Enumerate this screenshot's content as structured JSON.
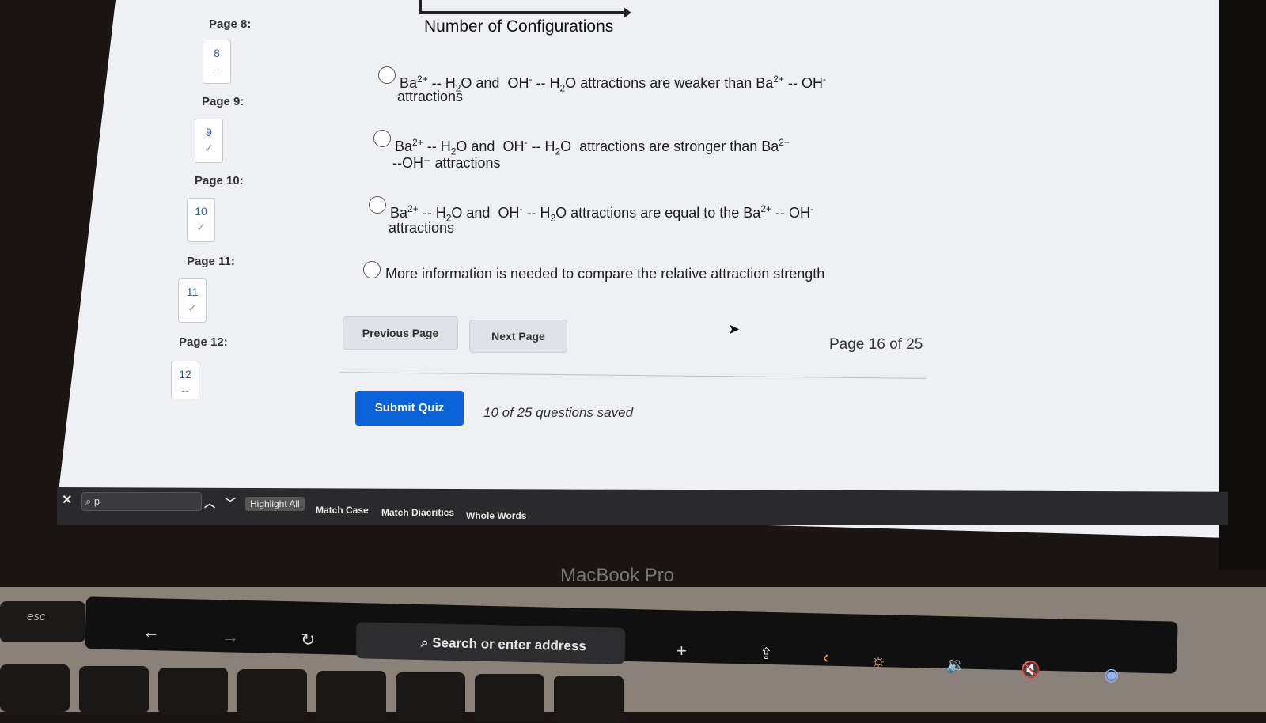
{
  "sidebar": {
    "pages": [
      {
        "label": "Page 8:",
        "number": "8",
        "status": "--"
      },
      {
        "label": "Page 9:",
        "number": "9",
        "status": "✓"
      },
      {
        "label": "Page 10:",
        "number": "10",
        "status": "✓"
      },
      {
        "label": "Page 11:",
        "number": "11",
        "status": "✓"
      },
      {
        "label": "Page 12:",
        "number": "12",
        "status": "--"
      }
    ]
  },
  "question": {
    "graph_label": "Number of Configurations",
    "options": [
      {
        "line1": "attractions are weaker than Ba",
        "line2": "attractions"
      },
      {
        "line1": "attractions are stronger than Ba",
        "line2": "--OH⁻  attractions"
      },
      {
        "line1": "attractions are equal to the Ba",
        "line2": "attractions"
      },
      {
        "line1": "More information is needed to compare the relative attraction strength"
      }
    ]
  },
  "nav": {
    "previous": "Previous Page",
    "next": "Next Page",
    "page_indicator": "Page 16 of 25"
  },
  "submit": {
    "label": "Submit Quiz",
    "saved": "10 of 25 questions saved"
  },
  "findbar": {
    "query": "p",
    "highlight_all": "Highlight All",
    "match_case": "Match Case",
    "match_diacritics": "Match Diacritics",
    "whole_words": "Whole Words"
  },
  "device": {
    "name": "MacBook Pro",
    "touchbar_search": "Search or enter address",
    "esc": "esc"
  }
}
